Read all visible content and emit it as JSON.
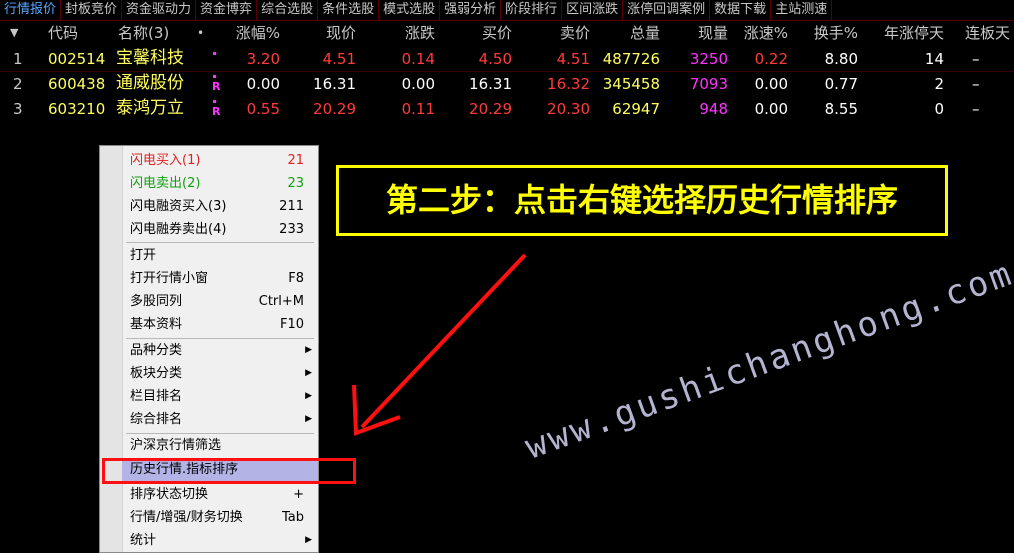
{
  "tabs": [
    "行情报价",
    "封板竞价",
    "资金驱动力",
    "资金博弈",
    "综合选股",
    "条件选股",
    "模式选股",
    "强弱分析",
    "阶段排行",
    "区间涨跌",
    "涨停回调案例",
    "数据下载",
    "主站测速"
  ],
  "table": {
    "sort_icon": "triangle-down",
    "headers": [
      "代码",
      "名称(3)",
      "•",
      "涨幅%",
      "现价",
      "涨跌",
      "买价",
      "卖价",
      "总量",
      "现量",
      "涨速%",
      "换手%",
      "年涨停天",
      "连板天"
    ],
    "rows": [
      {
        "idx": "1",
        "code": "002514",
        "name": "宝馨科技",
        "mark": "dot",
        "chg_pct": "3.20",
        "price": "4.51",
        "chg": "0.14",
        "bid": "4.50",
        "ask": "4.51",
        "vol": "487726",
        "cur_vol": "3250",
        "speed": "0.22",
        "turnover": "8.80",
        "year_limit": "14",
        "streak": "–"
      },
      {
        "idx": "2",
        "code": "600438",
        "name": "通威股份",
        "mark": "R",
        "chg_pct": "0.00",
        "price": "16.31",
        "chg": "0.00",
        "bid": "16.31",
        "ask": "16.32",
        "vol": "345458",
        "cur_vol": "7093",
        "speed": "0.00",
        "turnover": "0.77",
        "year_limit": "2",
        "streak": "–"
      },
      {
        "idx": "3",
        "code": "603210",
        "name": "泰鸿万立",
        "mark": "R",
        "chg_pct": "0.55",
        "price": "20.29",
        "chg": "0.11",
        "bid": "20.29",
        "ask": "20.30",
        "vol": "62947",
        "cur_vol": "948",
        "speed": "0.00",
        "turnover": "8.55",
        "year_limit": "0",
        "streak": "–"
      }
    ]
  },
  "context_menu": {
    "items": [
      {
        "label": "闪电买入(1)",
        "shortcut": "21"
      },
      {
        "label": "闪电卖出(2)",
        "shortcut": "23"
      },
      {
        "label": "闪电融资买入(3)",
        "shortcut": "211"
      },
      {
        "label": "闪电融券卖出(4)",
        "shortcut": "233"
      },
      {
        "label": "打开",
        "shortcut": ""
      },
      {
        "label": "打开行情小窗",
        "shortcut": "F8"
      },
      {
        "label": "多股同列",
        "shortcut": "Ctrl+M"
      },
      {
        "label": "基本资料",
        "shortcut": "F10"
      },
      {
        "label": "品种分类",
        "shortcut": ""
      },
      {
        "label": "板块分类",
        "shortcut": ""
      },
      {
        "label": "栏目排名",
        "shortcut": ""
      },
      {
        "label": "综合排名",
        "shortcut": ""
      },
      {
        "label": "沪深京行情筛选",
        "shortcut": ""
      },
      {
        "label": "历史行情.指标排序",
        "shortcut": ""
      },
      {
        "label": "排序状态切换",
        "shortcut": "+"
      },
      {
        "label": "行情/增强/财务切换",
        "shortcut": "Tab"
      },
      {
        "label": "统计",
        "shortcut": ""
      }
    ],
    "submenu_arrow": "▶"
  },
  "annotation": {
    "callout_text": "第二步：点击右键选择历史行情排序",
    "watermark": "www.gushichanghong.com"
  },
  "colors": {
    "up_red": "#ff3c3c",
    "yellow": "#ffff00",
    "magenta": "#ff33ff",
    "white": "#ffffff",
    "menu_highlight": "#b3b3e6"
  }
}
